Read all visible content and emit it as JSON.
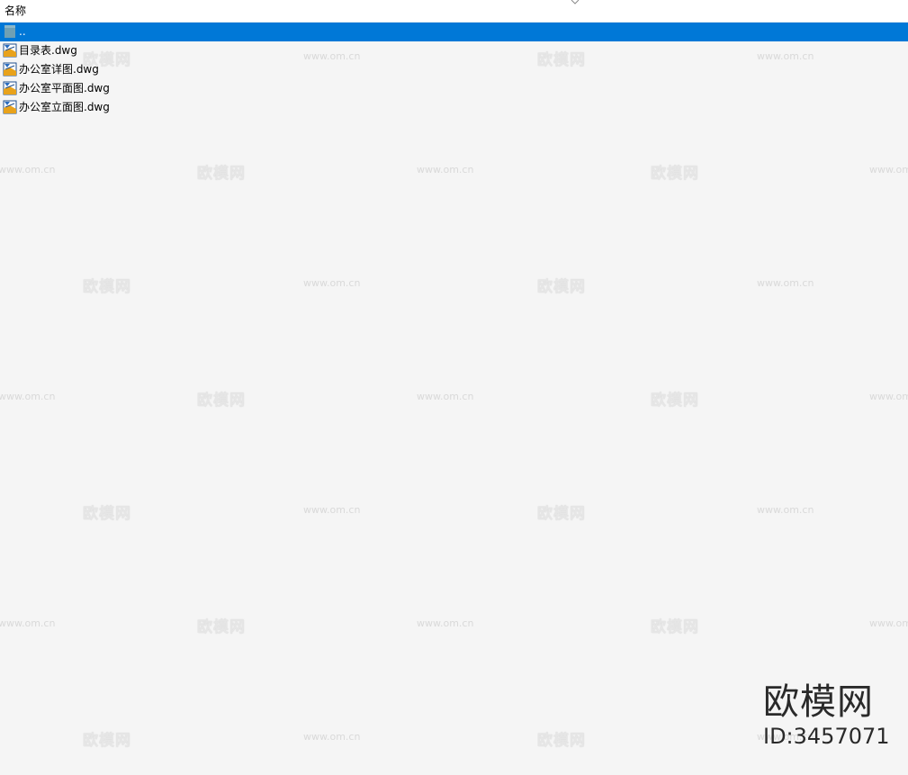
{
  "header": {
    "column_name": "名称",
    "sort_icon": "chevron-down-icon"
  },
  "files": [
    {
      "name": "..",
      "icon": "folder-up-icon",
      "selected": true
    },
    {
      "name": "目录表.dwg",
      "icon": "dwg-file-icon",
      "selected": false
    },
    {
      "name": "办公室详图.dwg",
      "icon": "dwg-file-icon",
      "selected": false
    },
    {
      "name": "办公室平面图.dwg",
      "icon": "dwg-file-icon",
      "selected": false
    },
    {
      "name": "办公室立面图.dwg",
      "icon": "dwg-file-icon",
      "selected": false
    }
  ],
  "colors": {
    "selection": "#0078d7",
    "background": "#f5f5f5"
  },
  "watermark": {
    "text_cn": "欧模网",
    "text_url": "www.om.cn",
    "brand_name": "欧模网",
    "brand_id": "ID:3457071"
  }
}
